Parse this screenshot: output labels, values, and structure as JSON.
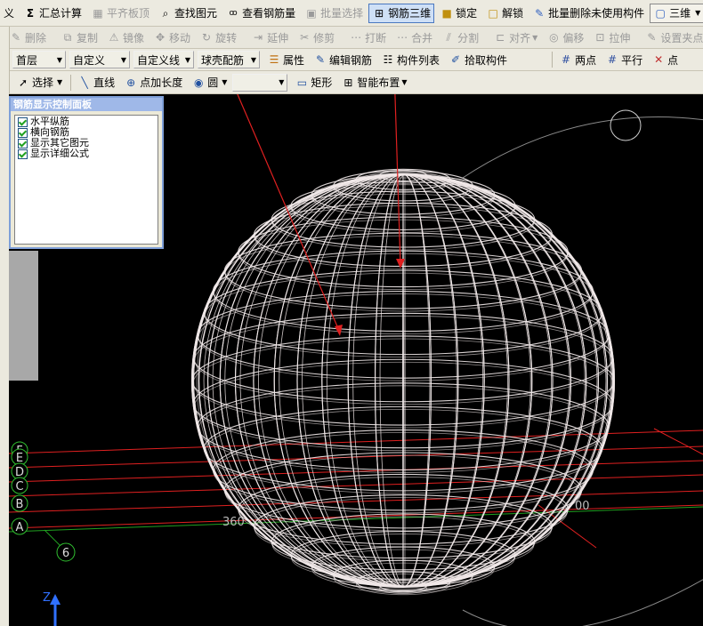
{
  "toolbar1": {
    "items": [
      {
        "label": "义",
        "icon": "",
        "disabled": false,
        "active": false
      },
      {
        "label": "汇总计算",
        "icon": "Σ",
        "disabled": false,
        "active": false
      },
      {
        "label": "平齐板顶",
        "icon": "▦",
        "disabled": true,
        "active": false
      },
      {
        "label": "查找图元",
        "icon": "🔍",
        "disabled": false,
        "active": false
      },
      {
        "label": "查看钢筋量",
        "icon": "60",
        "disabled": false,
        "active": false
      },
      {
        "label": "批量选择",
        "icon": "▣",
        "disabled": true,
        "active": false
      },
      {
        "label": "钢筋三维",
        "icon": "⊞",
        "disabled": false,
        "active": true
      },
      {
        "label": "锁定",
        "icon": "🔒",
        "disabled": false,
        "active": false
      },
      {
        "label": "解锁",
        "icon": "🔓",
        "disabled": false,
        "active": false
      },
      {
        "label": "批量删除未使用构件",
        "icon": "✎",
        "disabled": false,
        "active": false
      },
      {
        "label": "三维",
        "icon": "▢",
        "disabled": false,
        "active": false
      }
    ]
  },
  "toolbar2": {
    "items": [
      {
        "label": "删除",
        "icon": "✎"
      },
      {
        "label": "复制",
        "icon": "⧉"
      },
      {
        "label": "镜像",
        "icon": "⚠"
      },
      {
        "label": "移动",
        "icon": "✥"
      },
      {
        "label": "旋转",
        "icon": "↻"
      },
      {
        "label": "延伸",
        "icon": "⇥"
      },
      {
        "label": "修剪",
        "icon": "✂"
      },
      {
        "label": "打断",
        "icon": "⋯"
      },
      {
        "label": "合并",
        "icon": "⋯"
      },
      {
        "label": "分割",
        "icon": "⫽"
      },
      {
        "label": "对齐",
        "icon": "⊏"
      },
      {
        "label": "偏移",
        "icon": "◎"
      },
      {
        "label": "拉伸",
        "icon": "⊡"
      },
      {
        "label": "设置夹点",
        "icon": "✎"
      }
    ]
  },
  "toolbar3": {
    "floor": "首层",
    "type1": "自定义",
    "type2": "自定义线",
    "component": "球壳配筋",
    "items": [
      {
        "label": "属性",
        "icon": "☰"
      },
      {
        "label": "编辑钢筋",
        "icon": "✎"
      },
      {
        "label": "构件列表",
        "icon": "☷"
      },
      {
        "label": "拾取构件",
        "icon": "✐"
      },
      {
        "label": "两点",
        "icon": "#"
      },
      {
        "label": "平行",
        "icon": "#"
      },
      {
        "label": "点",
        "icon": "✕"
      }
    ]
  },
  "toolbar4": {
    "select": "选择",
    "line": "直线",
    "point_length": "点加长度",
    "circle": "圆",
    "blank_combo": "",
    "rect": "矩形",
    "smart": "智能布置"
  },
  "panel": {
    "title": "钢筋显示控制面板",
    "options": [
      "水平纵筋",
      "横向钢筋",
      "显示其它图元",
      "显示详细公式"
    ]
  },
  "grid": {
    "axes": [
      "F",
      "E",
      "D",
      "C",
      "B",
      "A"
    ],
    "number_axis": "6",
    "dim_left": "360",
    "dim_right": "00",
    "z_label": "Z"
  },
  "colors": {
    "background": "#000000",
    "wire": "#f0e8e8",
    "axis_red": "#e02020",
    "axis_green": "#20a020",
    "axis_marker": "#30c030",
    "z_arrow": "#3070ff"
  }
}
